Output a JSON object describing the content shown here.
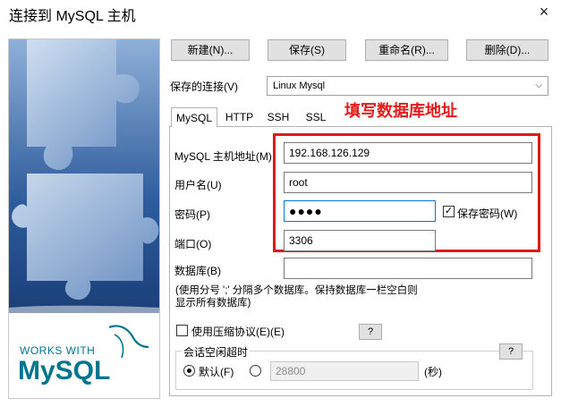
{
  "window": {
    "title": "连接到 MySQL 主机",
    "close_glyph": "×"
  },
  "toolbar": {
    "new_label": "新建(N)...",
    "save_label": "保存(S)",
    "rename_label": "重命名(R)...",
    "delete_label": "删除(D)..."
  },
  "saved_connection": {
    "label": "保存的连接(V)",
    "value": "Linux Mysql"
  },
  "tabs": [
    {
      "label": "MySQL",
      "active": true
    },
    {
      "label": "HTTP",
      "active": false
    },
    {
      "label": "SSH",
      "active": false
    },
    {
      "label": "SSL",
      "active": false
    }
  ],
  "annotation": {
    "text": "填写数据库地址",
    "color": "#e31b1b"
  },
  "form": {
    "host_label": "MySQL 主机地址(M)",
    "host_value": "192.168.126.129",
    "user_label": "用户名(U)",
    "user_value": "root",
    "password_label": "密码(P)",
    "password_mask": "●●●●",
    "save_password_label": "保存密码(W)",
    "save_password_checked": true,
    "port_label": "端口(O)",
    "port_value": "3306",
    "database_label": "数据库(B)",
    "database_value": "",
    "database_note_1": "(使用分号 ';' 分隔多个数据库。保持数据库一栏空白则",
    "database_note_2": "显示所有数据库)",
    "compression_label": "使用压缩协议(E)(E)",
    "compression_checked": false,
    "help_label": "?",
    "session_timeout_label": "会话空闲超时",
    "default_label": "默认(F)",
    "timeout_value": "28800",
    "seconds_label": "(秒)"
  },
  "side_image": {
    "works_with": "WORKS WITH",
    "brand": "MySQL",
    "brand_color": "#00758f",
    "accent_color": "#f29111"
  }
}
